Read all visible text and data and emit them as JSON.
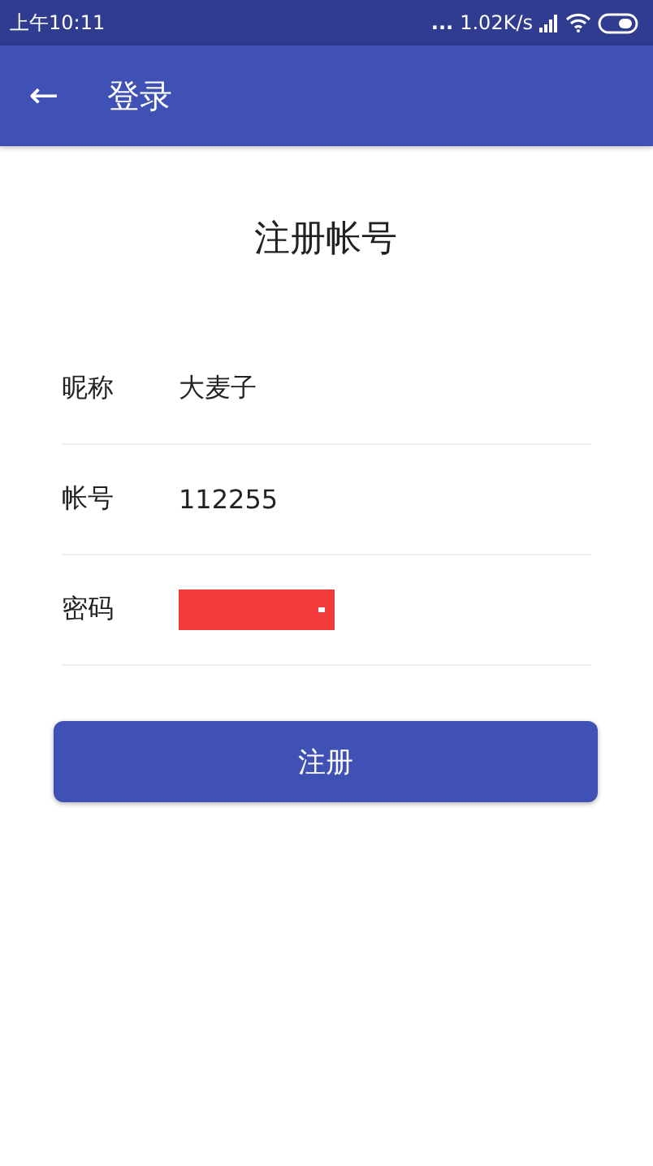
{
  "status_bar": {
    "time": "上午10:11",
    "dots": "...",
    "speed": "1.02K/s"
  },
  "app_bar": {
    "back": "←",
    "title": "登录"
  },
  "heading": "注册帐号",
  "fields": [
    {
      "label": "昵称",
      "kind": "text",
      "value": "大麦子"
    },
    {
      "label": "帐号",
      "kind": "text",
      "value": "112255"
    },
    {
      "label": "密码",
      "kind": "redacted"
    }
  ],
  "button": "注册"
}
